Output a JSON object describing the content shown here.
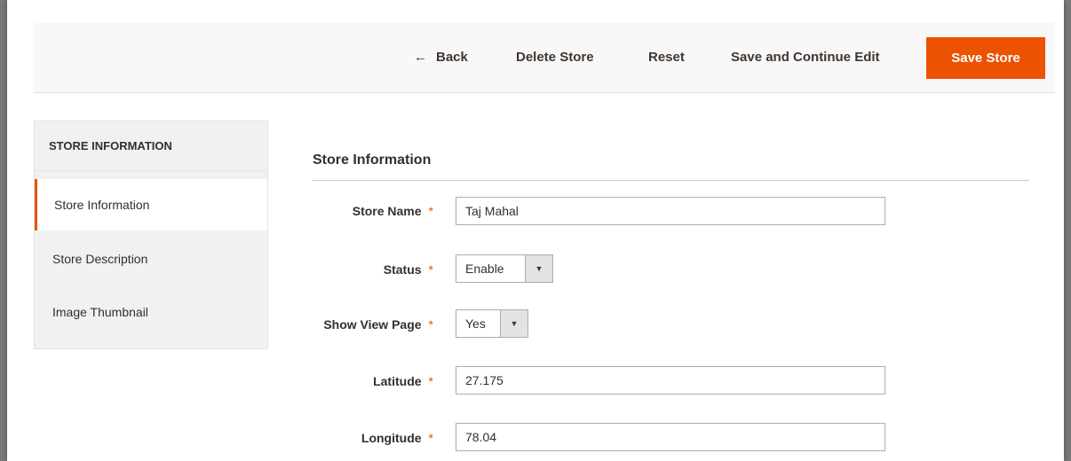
{
  "toolbar": {
    "back_label": "Back",
    "delete_label": "Delete Store",
    "reset_label": "Reset",
    "save_continue_label": "Save and Continue Edit",
    "save_label": "Save Store"
  },
  "sidebar": {
    "heading": "STORE INFORMATION",
    "items": [
      {
        "label": "Store Information",
        "active": true
      },
      {
        "label": "Store Description",
        "active": false
      },
      {
        "label": "Image Thumbnail",
        "active": false
      }
    ]
  },
  "section": {
    "title": "Store Information"
  },
  "form": {
    "required_marker": "*",
    "store_name": {
      "label": "Store Name",
      "value": "Taj Mahal"
    },
    "status": {
      "label": "Status",
      "value": "Enable"
    },
    "show_view_page": {
      "label": "Show View Page",
      "value": "Yes"
    },
    "latitude": {
      "label": "Latitude",
      "value": "27.175"
    },
    "longitude": {
      "label": "Longitude",
      "value": "78.04"
    }
  },
  "colors": {
    "accent": "#eb5202",
    "text": "#303030",
    "sidebar_bg": "#f1f1f1"
  },
  "icons": {
    "back": "left-arrow-icon",
    "dropdown": "caret-down-icon"
  }
}
